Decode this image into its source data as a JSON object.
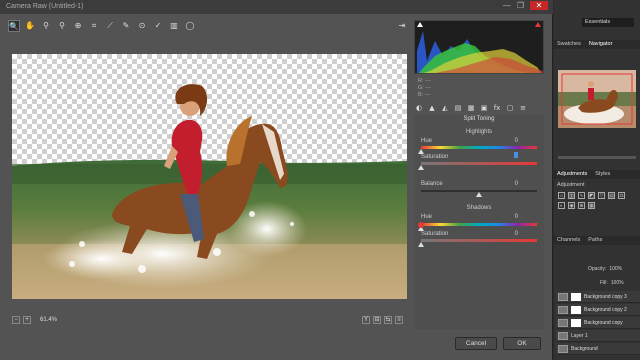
{
  "window": {
    "title": "Camera Raw (Untitled-1)",
    "minimize": "—",
    "maximize": "❐",
    "close": "✕"
  },
  "toolbar": {
    "tools": [
      {
        "name": "zoom-tool",
        "glyph": "🔍"
      },
      {
        "name": "hand-tool",
        "glyph": "✋"
      },
      {
        "name": "white-balance-tool",
        "glyph": "⚲"
      },
      {
        "name": "color-sampler-tool",
        "glyph": "⚲"
      },
      {
        "name": "targeted-adjustment-tool",
        "glyph": "⊕"
      },
      {
        "name": "crop-tool",
        "glyph": "⌗"
      },
      {
        "name": "straighten-tool",
        "glyph": "⟋"
      },
      {
        "name": "spot-removal-tool",
        "glyph": "✎"
      },
      {
        "name": "red-eye-tool",
        "glyph": "⊙"
      },
      {
        "name": "adjustment-brush-tool",
        "glyph": "✓"
      },
      {
        "name": "graduated-filter-tool",
        "glyph": "▥"
      },
      {
        "name": "radial-filter-tool",
        "glyph": "◯"
      }
    ],
    "prefs_glyph": "⇥"
  },
  "status": {
    "zoom": "61.4%",
    "minus": "−",
    "plus": "+"
  },
  "view_buttons": [
    "Y",
    "⊟",
    "⇆",
    "≡"
  ],
  "rgb_readout": {
    "r": "R:  ---",
    "g": "G:  ---",
    "b": "B:  ---"
  },
  "panel_tabs": [
    "◐",
    "▲",
    "◭",
    "▤",
    "▦",
    "▣",
    "fx",
    "▢",
    "≡"
  ],
  "split_toning": {
    "title": "Split Toning",
    "highlights": {
      "title": "Highlights",
      "hue_label": "Hue",
      "hue_value": "0",
      "hue_level": 0,
      "sat_label": "Saturation",
      "sat_value": "0",
      "sat_level": 0
    },
    "balance_label": "Balance",
    "balance_value": "0",
    "balance_level": 0.5,
    "shadows": {
      "title": "Shadows",
      "hue_label": "Hue",
      "hue_value": "0",
      "hue_level": 0,
      "sat_label": "Saturation",
      "sat_value": "0",
      "sat_level": 0
    }
  },
  "buttons": {
    "cancel": "Cancel",
    "ok": "OK"
  },
  "ps": {
    "workspace": "Essentials",
    "tab_swatches": "Swatches",
    "tab_navigator": "Navigator",
    "tab_adjustments": "Adjustments",
    "tab_styles": "Styles",
    "adjustment_label": "Adjustment",
    "tab_channels": "Channels",
    "tab_paths": "Paths",
    "opacity_label": "Opacity:",
    "opacity_value": "100%",
    "fill_label": "Fill:",
    "fill_value": "100%",
    "layers": [
      "Background copy 3",
      "Background copy 2",
      "Background copy",
      "Layer 1",
      "Background"
    ]
  }
}
